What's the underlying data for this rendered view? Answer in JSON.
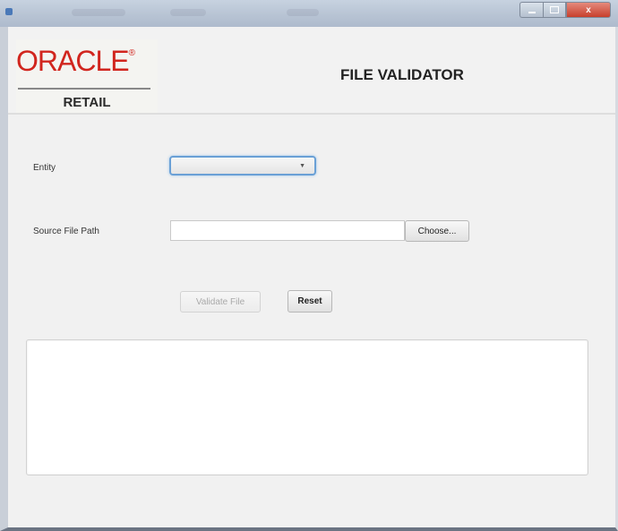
{
  "window": {
    "controls": {
      "minimize": "",
      "maximize": "",
      "close": "x"
    }
  },
  "logo": {
    "brand": "ORACLE",
    "registered": "®",
    "subbrand": "RETAIL"
  },
  "header": {
    "title": "FILE VALIDATOR"
  },
  "form": {
    "entity_label": "Entity",
    "entity_value": "",
    "source_path_label": "Source File Path",
    "source_path_value": "",
    "choose_button": "Choose...",
    "validate_button": "Validate File",
    "reset_button": "Reset",
    "output_text": ""
  },
  "colors": {
    "brand_red": "#d1251e",
    "focus_blue": "#6aa0d6"
  }
}
